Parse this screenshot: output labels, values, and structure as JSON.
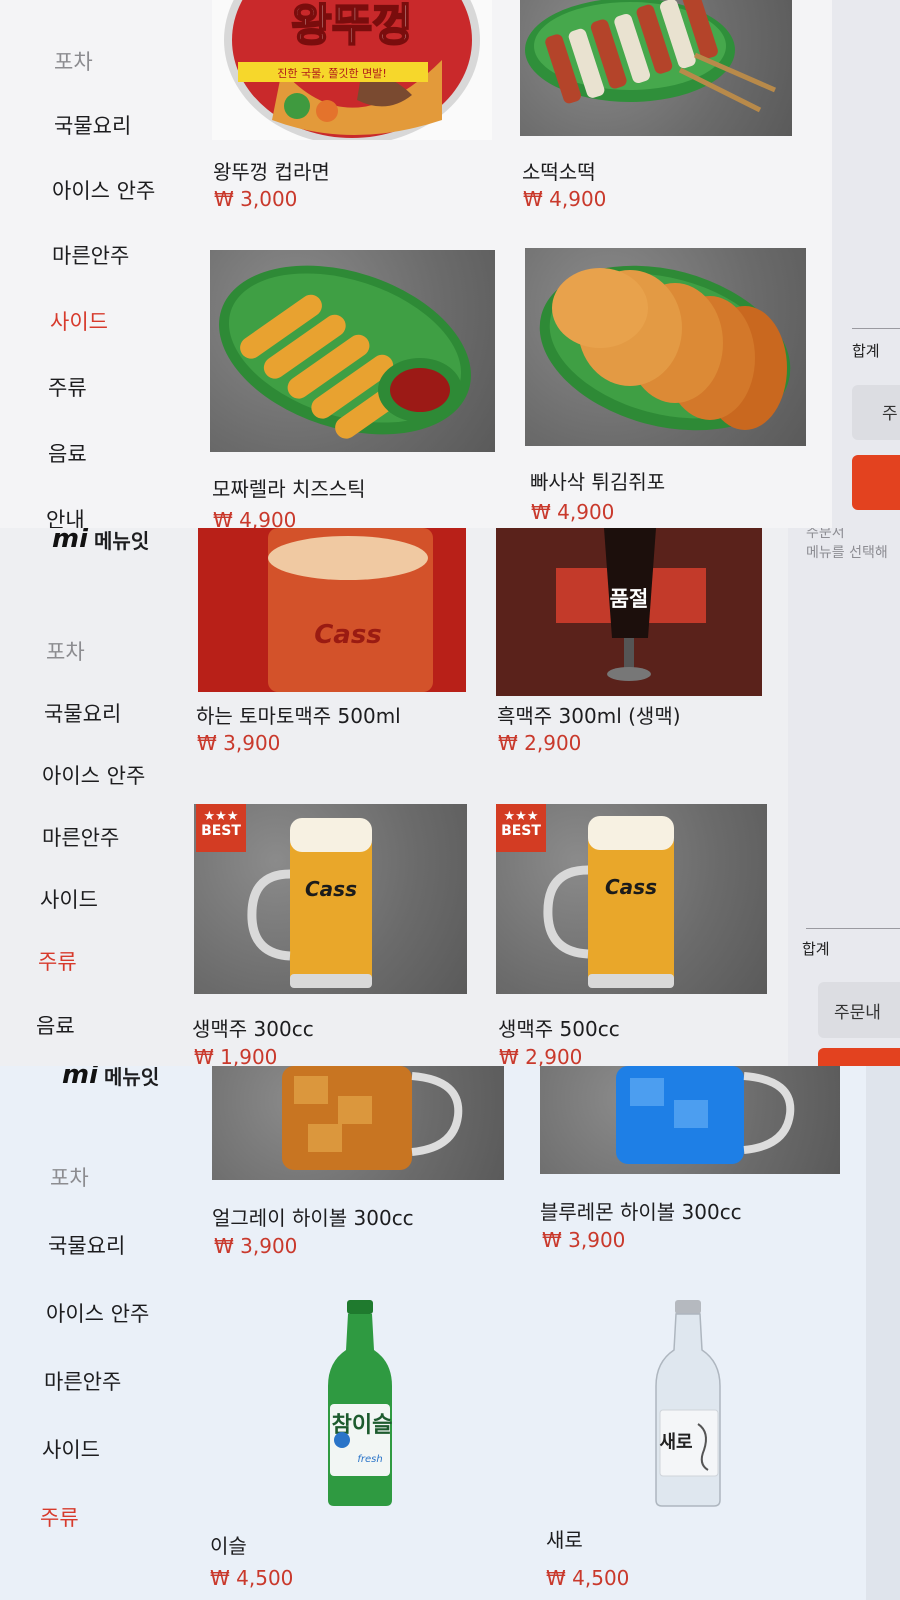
{
  "brand": {
    "name": "메뉴잇",
    "mark": "mi"
  },
  "nav_labels": [
    "포차",
    "국물요리",
    "아이스 안주",
    "마른안주",
    "사이드",
    "주류",
    "음료",
    "안내"
  ],
  "cart": {
    "sum_label": "합계",
    "hint": "메뉴를 선택해",
    "order_button": "주문내",
    "order_button_short": "주",
    "header_partial": "주문서"
  },
  "panel1": {
    "active_nav": "사이드",
    "items": [
      {
        "name": "왕뚜껑 컵라면",
        "price": "₩ 3,000",
        "package_text": "왕뚜껑",
        "package_sub": "진한 국물, 쫄깃한 면발!"
      },
      {
        "name": "소떡소떡",
        "price": "₩ 4,900"
      },
      {
        "name": "모짜렐라 치즈스틱",
        "price": "₩ 4,900"
      },
      {
        "name": "빠사삭 튀김쥐포",
        "price": "₩ 4,900"
      }
    ]
  },
  "panel2": {
    "active_nav": "주류",
    "items": [
      {
        "name": "하는 토마토맥주 500ml",
        "price": "₩ 3,900",
        "logo": "Cass"
      },
      {
        "name": "흑맥주 300ml (생맥)",
        "price": "₩ 2,900",
        "overlay": "품절"
      },
      {
        "name": "생맥주 300cc",
        "price": "₩ 1,900",
        "badge": "BEST",
        "logo": "Cass"
      },
      {
        "name": "생맥주 500cc",
        "price": "₩ 2,900",
        "badge": "BEST",
        "logo": "Cass"
      }
    ],
    "badge_stars": "★★★"
  },
  "panel3": {
    "active_nav": "주류",
    "items": [
      {
        "name": "얼그레이 하이볼 300cc",
        "price": "₩ 3,900"
      },
      {
        "name": "블루레몬 하이볼 300cc",
        "price": "₩ 3,900"
      },
      {
        "name": "이슬",
        "price": "₩ 4,500",
        "label": "참이슬",
        "label_sub": "fresh"
      },
      {
        "name": "새로",
        "price": "₩ 4,500",
        "label": "새로"
      }
    ]
  },
  "colors": {
    "accent_red": "#d73a2c",
    "price_red": "#c9392c",
    "order_red": "#e3421f",
    "badge_red": "#d33c23"
  }
}
